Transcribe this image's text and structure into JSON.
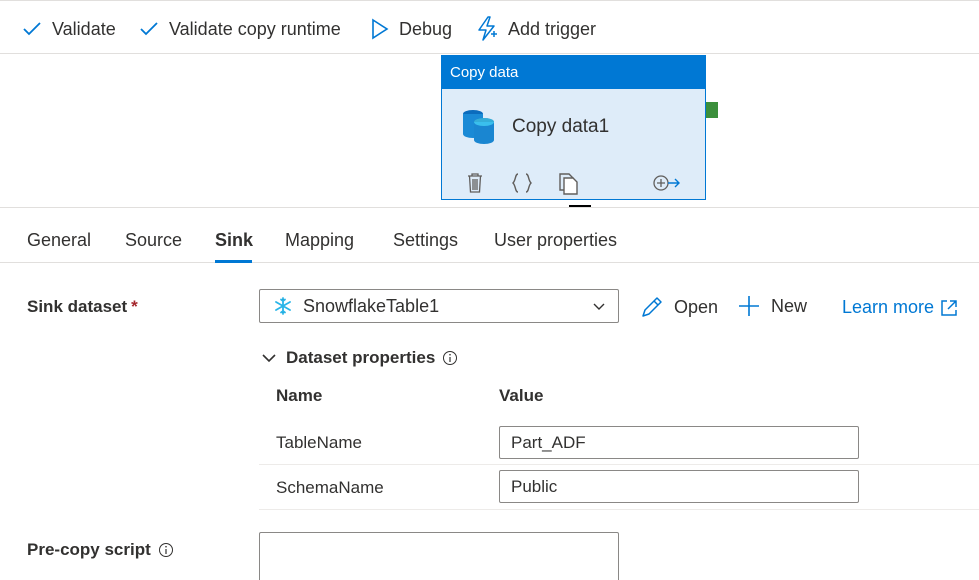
{
  "toolbar": {
    "validate_label": "Validate",
    "validate_runtime_label": "Validate copy runtime",
    "debug_label": "Debug",
    "add_trigger_label": "Add trigger"
  },
  "activity": {
    "header": "Copy data",
    "name": "Copy data1",
    "icons": [
      "delete-icon",
      "code-icon",
      "copy-icon",
      "add-output-icon"
    ]
  },
  "tabs": [
    {
      "label": "General"
    },
    {
      "label": "Source"
    },
    {
      "label": "Sink",
      "active": true
    },
    {
      "label": "Mapping"
    },
    {
      "label": "Settings"
    },
    {
      "label": "User properties"
    }
  ],
  "sink": {
    "dataset_label": "Sink dataset",
    "required_mark": "*",
    "dataset_value": "SnowflakeTable1",
    "open_label": "Open",
    "new_label": "New",
    "learn_more_label": "Learn more"
  },
  "dataset_properties": {
    "title": "Dataset properties",
    "name_header": "Name",
    "value_header": "Value",
    "rows": [
      {
        "name": "TableName",
        "value": "Part_ADF"
      },
      {
        "name": "SchemaName",
        "value": "Public"
      }
    ]
  },
  "pre_copy": {
    "label": "Pre-copy script",
    "value": ""
  },
  "colors": {
    "accent": "#0078d4",
    "activity_bg": "#deecf9",
    "port_green": "#3b8f3b",
    "required_red": "#a4262c"
  }
}
